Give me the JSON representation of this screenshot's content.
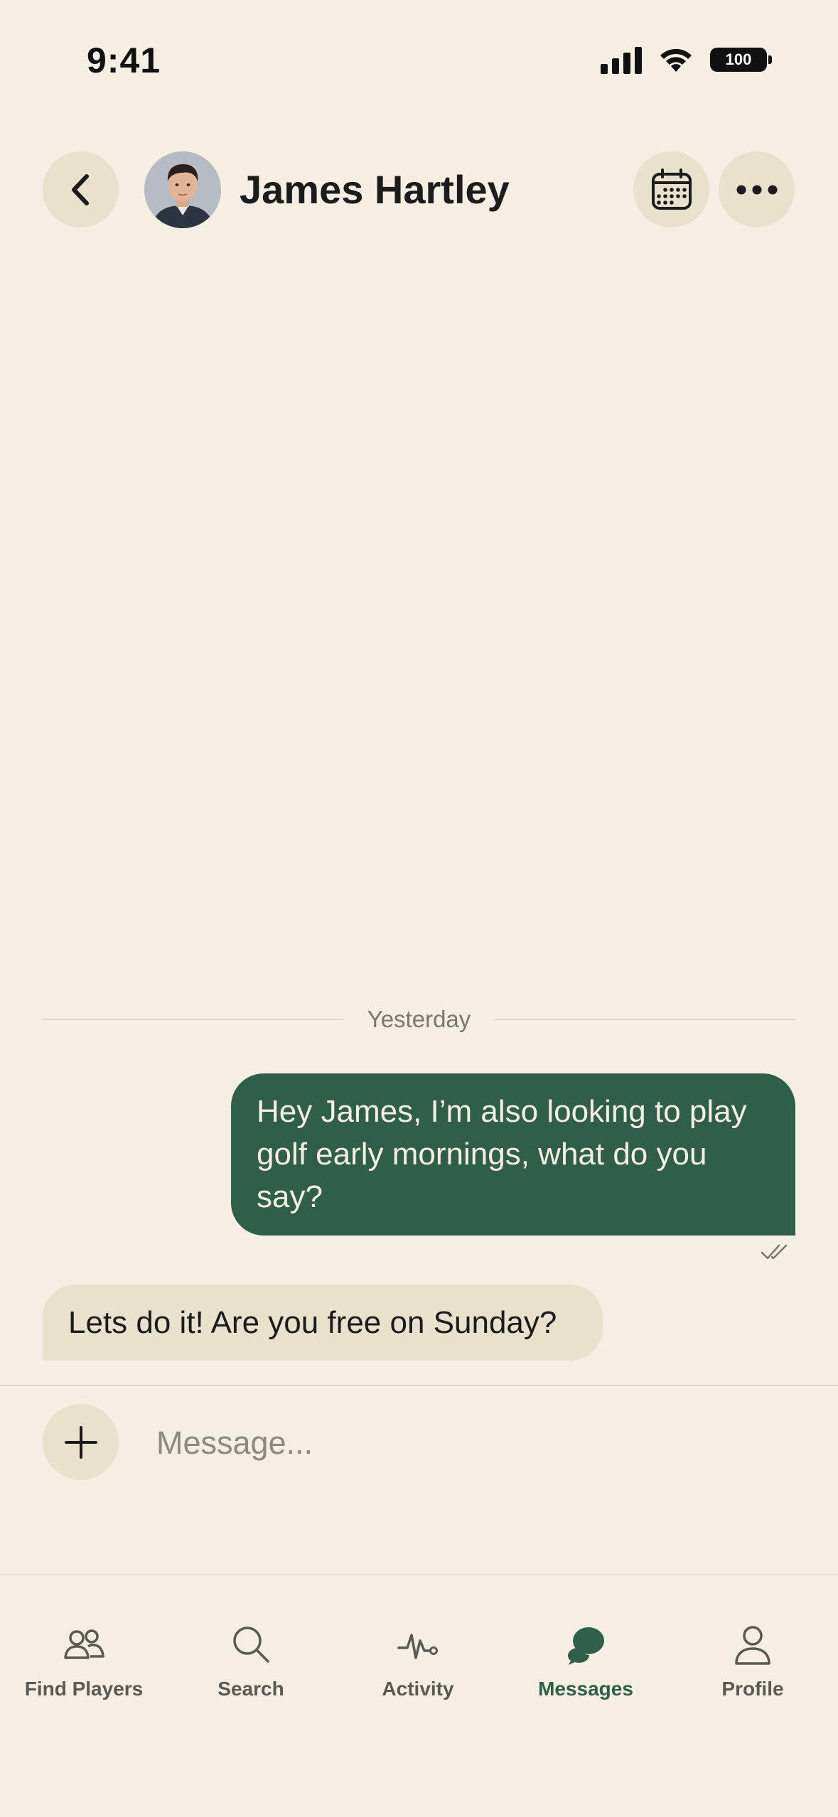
{
  "status_bar": {
    "time": "9:41",
    "battery": "100"
  },
  "header": {
    "contact_name": "James Hartley",
    "back_icon": "chevron-left-icon",
    "calendar_icon": "calendar-icon",
    "more_icon": "ellipsis-icon"
  },
  "conversation": {
    "date_label": "Yesterday",
    "messages": [
      {
        "direction": "outgoing",
        "text": "Hey James, I’m also looking to play golf early mornings, what do you say?",
        "status_icon": "double-check-icon"
      },
      {
        "direction": "incoming",
        "text": "Lets do it! Are you free on Sunday?"
      }
    ]
  },
  "composer": {
    "add_icon": "plus-icon",
    "placeholder": "Message...",
    "value": ""
  },
  "tabbar": {
    "items": [
      {
        "label": "Find Players",
        "icon": "people-icon",
        "active": false
      },
      {
        "label": "Search",
        "icon": "search-icon",
        "active": false
      },
      {
        "label": "Activity",
        "icon": "pulse-icon",
        "active": false
      },
      {
        "label": "Messages",
        "icon": "chat-bubbles-icon",
        "active": true
      },
      {
        "label": "Profile",
        "icon": "person-icon",
        "active": false
      }
    ]
  },
  "colors": {
    "background": "#f4efe2",
    "accent_green": "#2f5f4a",
    "bubble_beige": "#e8e1cc"
  }
}
